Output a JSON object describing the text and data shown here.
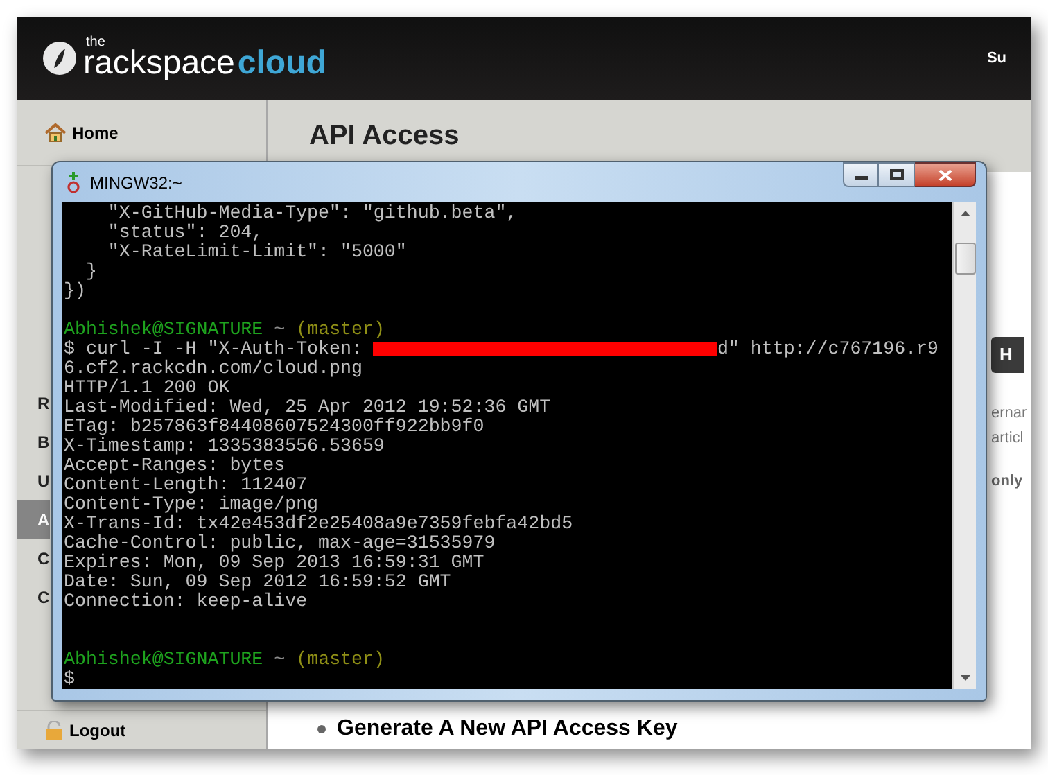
{
  "header": {
    "logo_small": "the",
    "logo_main": "rackspace",
    "logo_accent": "cloud",
    "user_link": "Su"
  },
  "sidebar": {
    "items": [
      {
        "label": "Home",
        "kind": "home",
        "selected": false
      },
      {
        "label": "R",
        "kind": "plain",
        "selected": false
      },
      {
        "label": "B",
        "kind": "plain",
        "selected": false
      },
      {
        "label": "U",
        "kind": "plain",
        "selected": false
      },
      {
        "label": "A",
        "kind": "plain",
        "selected": true
      },
      {
        "label": "C",
        "kind": "plain",
        "selected": false
      },
      {
        "label": "C",
        "kind": "plain",
        "selected": false
      }
    ],
    "logout": "Logout"
  },
  "main": {
    "title": "API Access",
    "side_button": "H",
    "side_texts": [
      "ernar",
      "articl"
    ],
    "side_bold": "only",
    "bullet": "Generate A New API Access Key"
  },
  "terminal": {
    "title": "MINGW32:~",
    "lines": [
      {
        "kind": "output",
        "text": "    \"X-GitHub-Media-Type\": \"github.beta\","
      },
      {
        "kind": "output",
        "text": "    \"status\": 204,"
      },
      {
        "kind": "output",
        "text": "    \"X-RateLimit-Limit\": \"5000\""
      },
      {
        "kind": "output",
        "text": "  }"
      },
      {
        "kind": "output",
        "text": "})"
      },
      {
        "kind": "blank"
      },
      {
        "kind": "prompt",
        "user": "Abhishek@SIGNATURE",
        "path": "~",
        "branch": "(master)"
      },
      {
        "kind": "redacted",
        "before": "$ curl -I -H \"X-Auth-Token: ",
        "after": "d\" http://c767196.r9"
      },
      {
        "kind": "output",
        "text": "6.cf2.rackcdn.com/cloud.png"
      },
      {
        "kind": "output",
        "text": "HTTP/1.1 200 OK"
      },
      {
        "kind": "output",
        "text": "Last-Modified: Wed, 25 Apr 2012 19:52:36 GMT"
      },
      {
        "kind": "output",
        "text": "ETag: b257863f84408607524300ff922bb9f0"
      },
      {
        "kind": "output",
        "text": "X-Timestamp: 1335383556.53659"
      },
      {
        "kind": "output",
        "text": "Accept-Ranges: bytes"
      },
      {
        "kind": "output",
        "text": "Content-Length: 112407"
      },
      {
        "kind": "output",
        "text": "Content-Type: image/png"
      },
      {
        "kind": "output",
        "text": "X-Trans-Id: tx42e453df2e25408a9e7359febfa42bd5"
      },
      {
        "kind": "output",
        "text": "Cache-Control: public, max-age=31535979"
      },
      {
        "kind": "output",
        "text": "Expires: Mon, 09 Sep 2013 16:59:31 GMT"
      },
      {
        "kind": "output",
        "text": "Date: Sun, 09 Sep 2012 16:59:52 GMT"
      },
      {
        "kind": "output",
        "text": "Connection: keep-alive"
      },
      {
        "kind": "blank"
      },
      {
        "kind": "blank"
      },
      {
        "kind": "prompt",
        "user": "Abhishek@SIGNATURE",
        "path": "~",
        "branch": "(master)"
      },
      {
        "kind": "output",
        "text": "$"
      }
    ]
  }
}
